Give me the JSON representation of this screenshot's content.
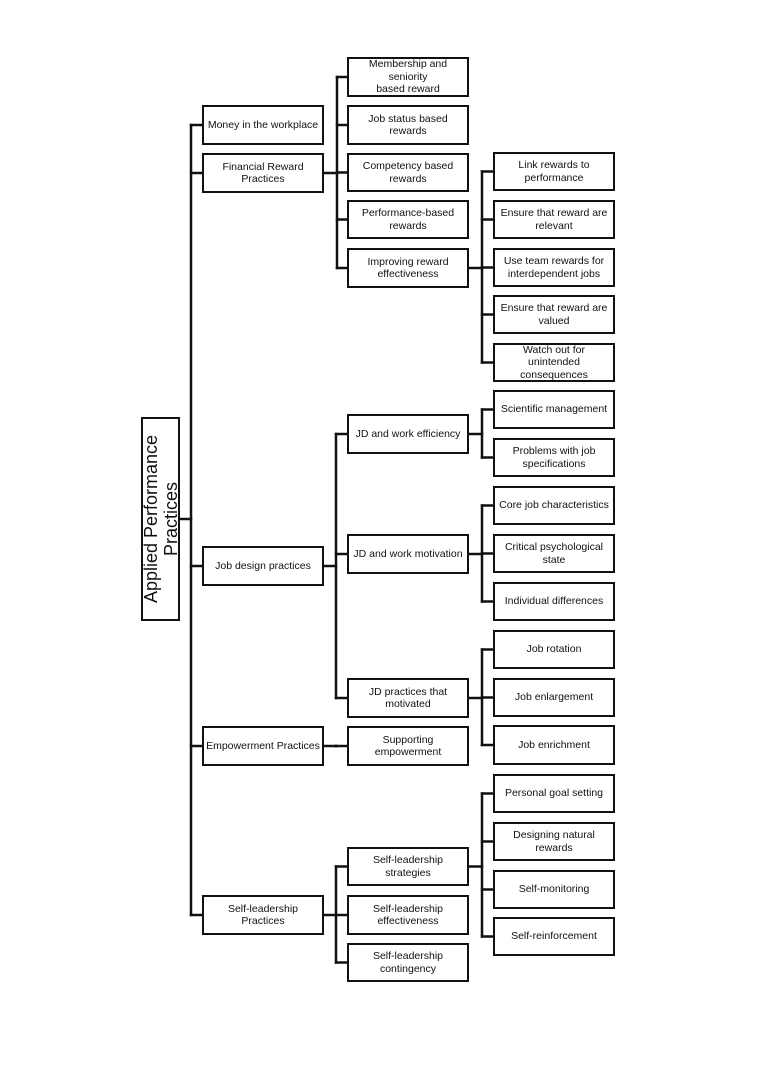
{
  "diagram": {
    "root": {
      "label": "Applied Performance\nPractices"
    },
    "branches": [
      {
        "label": "Money in the workplace",
        "children": []
      },
      {
        "label": "Financial Reward\nPractices",
        "children": [
          {
            "label": "Membership and seniority\nbased reward",
            "children": []
          },
          {
            "label": "Job status based rewards",
            "children": []
          },
          {
            "label": "Competency based\nrewards",
            "children": []
          },
          {
            "label": "Performance-based\nrewards",
            "children": []
          },
          {
            "label": "Improving reward\neffectiveness",
            "children": [
              {
                "label": "Link rewards to\nperformance"
              },
              {
                "label": "Ensure that reward are\nrelevant"
              },
              {
                "label": "Use team rewards for\ninterdependent jobs"
              },
              {
                "label": "Ensure that reward are\nvalued"
              },
              {
                "label": "Watch out for unintended\nconsequences"
              }
            ]
          }
        ]
      },
      {
        "label": "Job design practices",
        "children": [
          {
            "label": "JD and work efficiency",
            "children": [
              {
                "label": "Scientific management"
              },
              {
                "label": "Problems with job\nspecifications"
              }
            ]
          },
          {
            "label": "JD and work motivation",
            "children": [
              {
                "label": "Core job characteristics"
              },
              {
                "label": "Critical psychological state"
              },
              {
                "label": "Individual differences"
              }
            ]
          },
          {
            "label": "JD practices that\nmotivated",
            "children": [
              {
                "label": "Job rotation"
              },
              {
                "label": "Job enlargement"
              },
              {
                "label": "Job enrichment"
              }
            ]
          }
        ]
      },
      {
        "label": "Empowerment Practices",
        "children": [
          {
            "label": "Supporting\nempowerment",
            "children": []
          }
        ]
      },
      {
        "label": "Self-leadership Practices",
        "children": [
          {
            "label": "Self-leadership strategies",
            "children": [
              {
                "label": "Personal goal setting"
              },
              {
                "label": "Designing natural rewards"
              },
              {
                "label": "Self-monitoring"
              },
              {
                "label": "Self-reinforcement"
              }
            ]
          },
          {
            "label": "Self-leadership\neffectiveness",
            "children": []
          },
          {
            "label": "Self-leadership\ncontingency",
            "children": []
          }
        ]
      }
    ]
  }
}
